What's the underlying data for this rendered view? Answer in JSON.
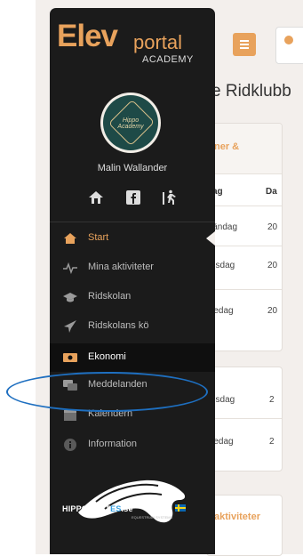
{
  "app": {
    "title_main": "Elev",
    "title_sub": "portal",
    "subtitle": "ACADEMY"
  },
  "avatar": {
    "line1": "Hippo",
    "line2": "Academy"
  },
  "user": {
    "name": "Malin Wallander"
  },
  "quick_links": [
    {
      "icon": "house-icon"
    },
    {
      "icon": "facebook-icon"
    },
    {
      "icon": "logout-icon"
    }
  ],
  "nav": {
    "items": [
      {
        "label": "Start",
        "icon": "home-icon",
        "active": true
      },
      {
        "label": "Mina aktiviteter",
        "icon": "activity-icon"
      },
      {
        "label": "Ridskolan",
        "icon": "graduation-cap-icon"
      },
      {
        "label": "Ridskolans kö",
        "icon": "paper-plane-icon"
      },
      {
        "label": "Ekonomi",
        "icon": "money-icon",
        "highlight": true
      },
      {
        "label": "Meddelanden",
        "icon": "messages-icon"
      },
      {
        "label": "Kalendern",
        "icon": "calendar-icon"
      },
      {
        "label": "Information",
        "icon": "info-icon"
      }
    ]
  },
  "brand": {
    "name_a": "HIPPOCRAT",
    "name_b": "ES",
    "name_c": ".se",
    "tagline": "EQUESTRIAN SYSTEMS"
  },
  "main": {
    "heading": "e Ridklubb",
    "card1": {
      "title_line1": "ner &",
      "columns": [
        "ag",
        "Da"
      ],
      "rows": [
        [
          "ländag",
          "20"
        ],
        [
          "nsdag",
          "20"
        ],
        [
          "redag",
          "20"
        ]
      ]
    },
    "card2": {
      "rows": [
        [
          "nsdag",
          "2"
        ],
        [
          "redag",
          "2"
        ]
      ]
    },
    "card3": {
      "title": "aktiviteter"
    }
  },
  "colors": {
    "accent": "#e8a25c",
    "sidebar": "#1b1b1b",
    "highlight": "#1e6fc0"
  }
}
